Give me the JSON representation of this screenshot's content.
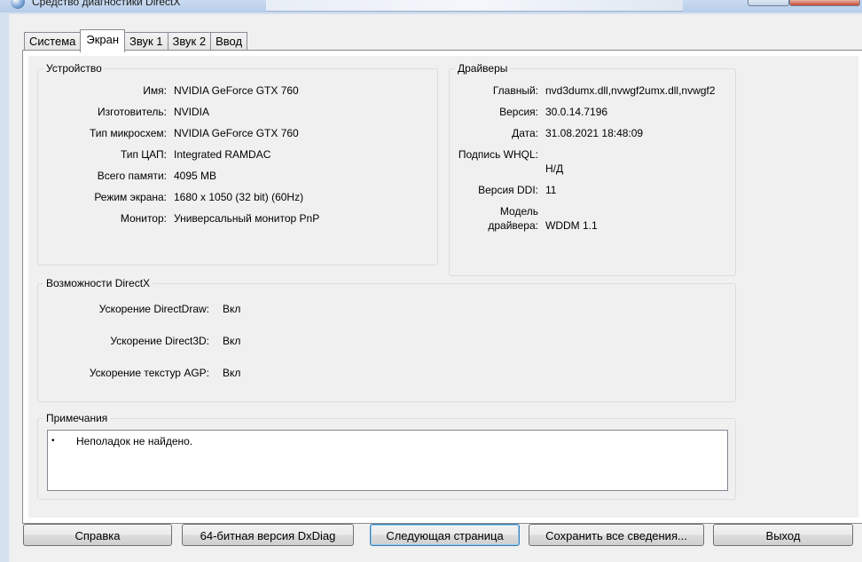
{
  "window": {
    "title": "Средство диагностики DirectX"
  },
  "tabs": [
    {
      "label": "Система",
      "active": false
    },
    {
      "label": "Экран",
      "active": true
    },
    {
      "label": "Звук 1",
      "active": false
    },
    {
      "label": "Звук 2",
      "active": false
    },
    {
      "label": "Ввод",
      "active": false
    }
  ],
  "device": {
    "group_title": "Устройство",
    "rows": [
      {
        "label": "Имя:",
        "value": "NVIDIA GeForce GTX 760"
      },
      {
        "label": "Изготовитель:",
        "value": "NVIDIA"
      },
      {
        "label": "Тип микросхем:",
        "value": "NVIDIA GeForce GTX 760"
      },
      {
        "label": "Тип ЦАП:",
        "value": "Integrated RAMDAC"
      },
      {
        "label": "Всего памяти:",
        "value": "4095 MB"
      },
      {
        "label": "Режим экрана:",
        "value": "1680 x 1050 (32 bit) (60Hz)"
      },
      {
        "label": "Монитор:",
        "value": "Универсальный монитор PnP"
      }
    ]
  },
  "drivers": {
    "group_title": "Драйверы",
    "main_label": "Главный:",
    "main_value": "nvd3dumx.dll,nvwgf2umx.dll,nvwgf2",
    "version_label": "Версия:",
    "version_value": "30.0.14.7196",
    "date_label": "Дата:",
    "date_value": "31.08.2021 18:48:09",
    "whql_label": "Подпись WHQL:",
    "whql_value": "Н/Д",
    "ddi_label": "Версия DDI:",
    "ddi_value": "11",
    "model_label_1": "Модель",
    "model_label_2": "драйвера:",
    "model_value": "WDDM 1.1"
  },
  "directx": {
    "group_title": "Возможности DirectX",
    "rows": [
      {
        "label": "Ускорение DirectDraw:",
        "value": "Вкл"
      },
      {
        "label": "Ускорение Direct3D:",
        "value": "Вкл"
      },
      {
        "label": "Ускорение текстур AGP:",
        "value": "Вкл"
      }
    ]
  },
  "notes": {
    "group_title": "Примечания",
    "bullet": "•",
    "text": "Неполадок не найдено."
  },
  "buttons": {
    "help": "Справка",
    "dxdiag64": "64-битная версия DxDiag",
    "next_page": "Следующая страница",
    "save_all": "Сохранить все сведения...",
    "exit": "Выход"
  }
}
